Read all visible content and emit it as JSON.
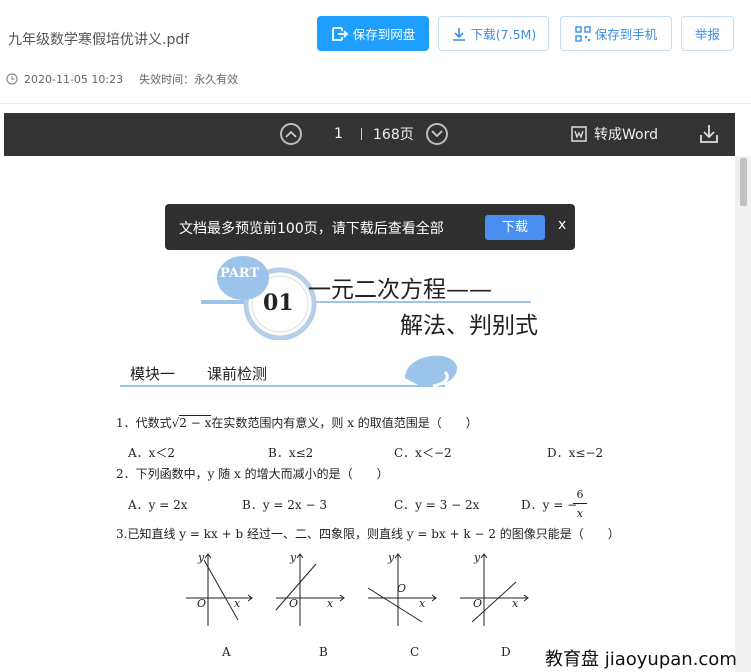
{
  "header": {
    "title": "九年级数学寒假培优讲义.pdf",
    "date": "2020-11-05 10:23",
    "expire_label": "失效时间：永久有效",
    "buttons": {
      "save_cloud": "保存到网盘",
      "download": "下载(7.5M)",
      "save_phone": "保存到手机",
      "report": "举报"
    }
  },
  "toolbar": {
    "current_page": "1",
    "total_pages": "168页",
    "to_word": "转成Word"
  },
  "notice": {
    "text": "文档最多预览前100页，请下载后查看全部",
    "button": "下载",
    "close": "x"
  },
  "doc": {
    "part_label": "PART",
    "part_number": "01",
    "heading_main": "一元二次方程——",
    "heading_sub": "解法、判别式",
    "module_title": "模块一",
    "module_name": "课前检测",
    "q1": {
      "pre": "1．代数式",
      "radicand": "2 − x",
      "post": "在实数范围内有意义，则 x 的取值范围是（　　）",
      "options": [
        "A．x＜2",
        "B．x≤2",
        "C．x＜−2",
        "D．x≤−2"
      ]
    },
    "q2": {
      "text": "2．下列函数中，y 随 x 的增大而减小的是（　　）",
      "options": [
        "A．y = 2x",
        "B．y = 2x − 3",
        "C．y = 3 − 2x",
        "D．y = −"
      ],
      "frac_num": "6",
      "frac_den": "x"
    },
    "q3": {
      "text": "3.已知直线 y = kx + b 经过一、二、四象限，则直线 y = bx + k − 2 的图像只能是（　　）",
      "graph_labels": [
        "A",
        "B",
        "C",
        "D"
      ],
      "axis_y": "y",
      "axis_x": "x",
      "origin": "O"
    }
  },
  "watermark": "教育盘 jiaoyupan.com",
  "colors": {
    "primary": "#1e9fff",
    "toolbar_bg": "#333333",
    "accent_blue": "#9cc3ea"
  }
}
